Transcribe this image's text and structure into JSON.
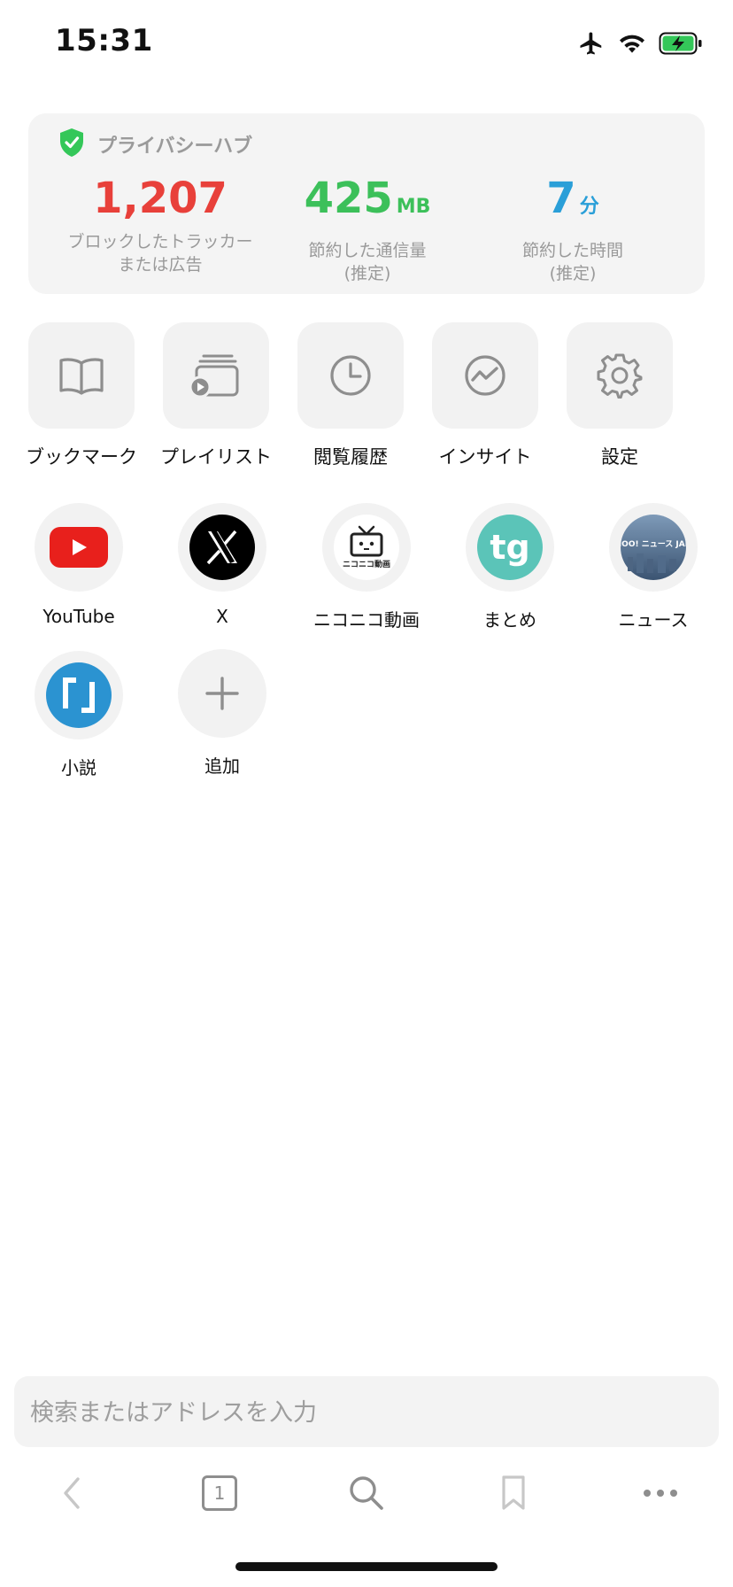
{
  "status_bar": {
    "time": "15:31"
  },
  "privacy_hub": {
    "title": "プライバシーハブ",
    "stats": [
      {
        "value": "1,207",
        "unit": "",
        "label_line1": "ブロックしたトラッカー",
        "label_line2": "または広告",
        "color": "#e8403a"
      },
      {
        "value": "425",
        "unit": "MB",
        "label_line1": "節約した通信量",
        "label_line2": "(推定)",
        "color": "#3cc05a"
      },
      {
        "value": "7",
        "unit": "分",
        "label_line1": "節約した時間",
        "label_line2": "(推定)",
        "color": "#2a9fd8"
      }
    ]
  },
  "quick_actions": [
    {
      "label": "ブックマーク",
      "icon": "book-icon"
    },
    {
      "label": "プレイリスト",
      "icon": "playlist-icon"
    },
    {
      "label": "閲覧履歴",
      "icon": "clock-icon"
    },
    {
      "label": "インサイト",
      "icon": "insight-icon"
    },
    {
      "label": "設定",
      "icon": "gear-icon"
    }
  ],
  "favorites": [
    {
      "label": "YouTube",
      "icon": "youtube-icon"
    },
    {
      "label": "X",
      "icon": "x-icon"
    },
    {
      "label": "ニコニコ動画",
      "icon": "niconico-icon",
      "logo_text": "ニコニコ動画"
    },
    {
      "label": "まとめ",
      "icon": "matome-icon",
      "logo_text": "tg"
    },
    {
      "label": "ニュース",
      "icon": "yahoo-news-icon",
      "logo_text": "YAHOO! ニュース JAPAN"
    },
    {
      "label": "小説",
      "icon": "novel-icon",
      "logo_text": "「」"
    },
    {
      "label": "追加",
      "icon": "plus-icon"
    }
  ],
  "search": {
    "placeholder": "検索またはアドレスを入力"
  },
  "toolbar": {
    "tab_count": "1"
  },
  "colors": {
    "accent_red": "#e8403a",
    "accent_green": "#3cc05a",
    "accent_blue": "#2a9fd8"
  }
}
